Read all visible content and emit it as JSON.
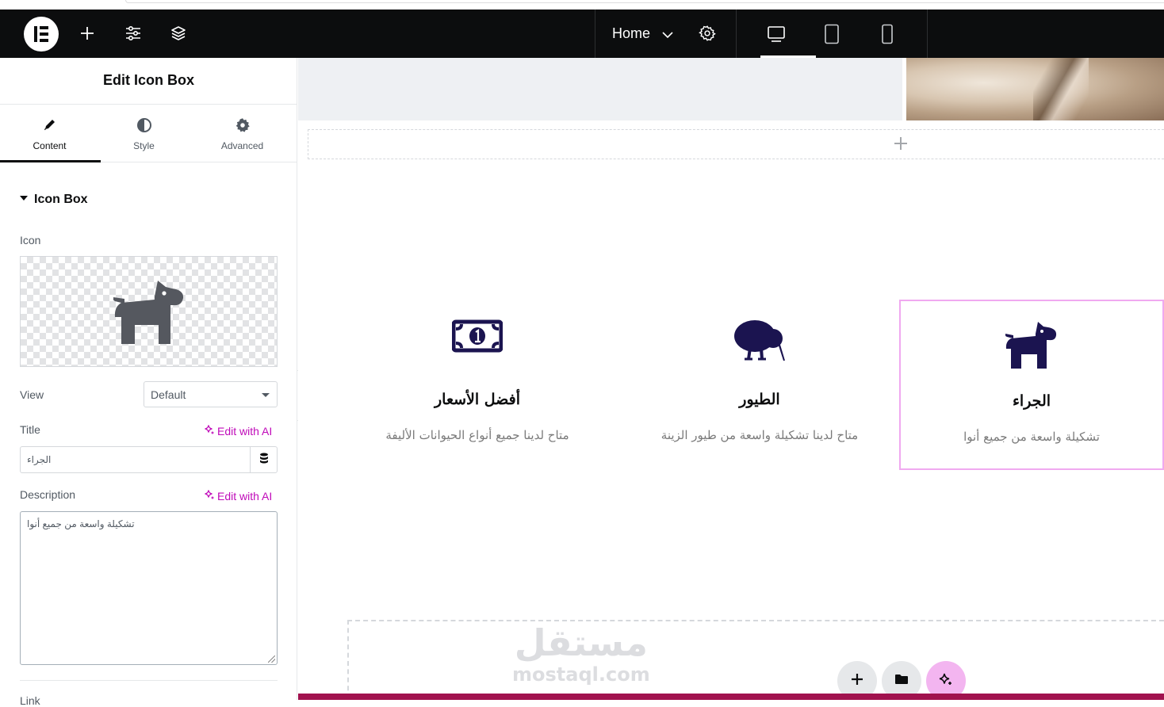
{
  "topbar": {
    "page_name": "Home"
  },
  "panel": {
    "title": "Edit Icon Box",
    "tabs": [
      {
        "label": "Content"
      },
      {
        "label": "Style"
      },
      {
        "label": "Advanced"
      }
    ],
    "section": "Icon Box",
    "icon_label": "Icon",
    "view_label": "View",
    "view_value": "Default",
    "title_label": "Title",
    "title_value": "الجراء",
    "edit_ai": "Edit with AI",
    "description_label": "Description",
    "description_value": "تشكيلة واسعة من جميع أنوا",
    "next_label": "Link"
  },
  "canvas": {
    "cards": [
      {
        "icon": "money-bill-icon",
        "title": "أفضل الأسعار",
        "description": "متاح لدينا جميع أنواع الحيوانات الأليفة"
      },
      {
        "icon": "kiwi-bird-icon",
        "title": "الطيور",
        "description": "متاح لدينا تشكيلة واسعة من طيور الزينة"
      },
      {
        "icon": "dog-icon",
        "title": "الجراء",
        "description": "تشكيلة واسعة من جميع أنوا"
      }
    ],
    "watermark_ar": "مستقل",
    "watermark_en": "mostaql.com"
  },
  "colors": {
    "topbar": "#0c0d0e",
    "accent_ai": "#c00bb9",
    "icon_navy": "#1b1450",
    "selection": "#f0a9f0",
    "bottom_bar": "#a1124e"
  }
}
